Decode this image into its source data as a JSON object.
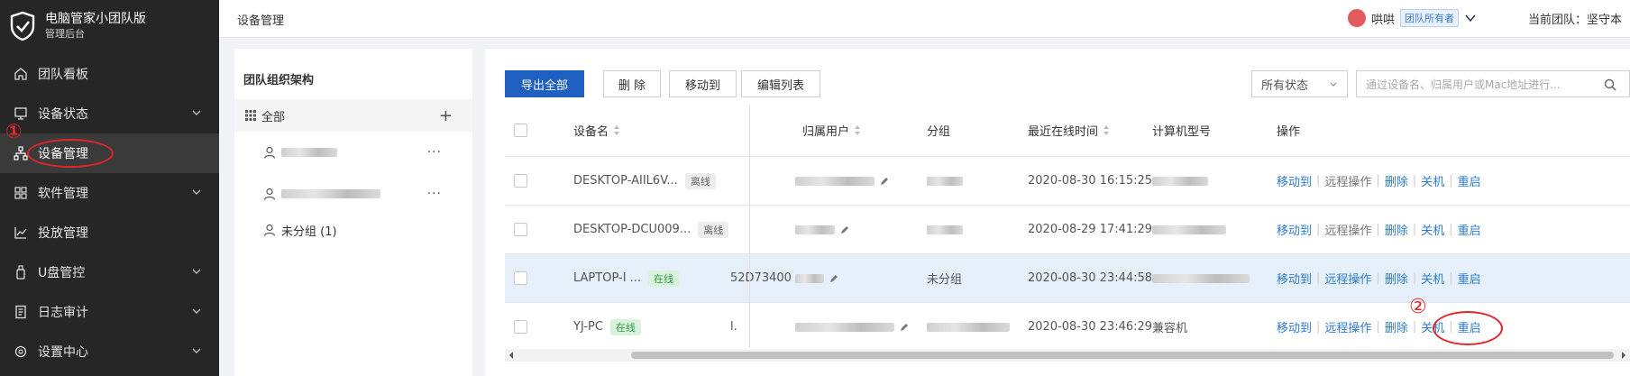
{
  "app": {
    "title": "电脑管家小团队版",
    "subtitle": "管理后台"
  },
  "sidebar": {
    "items": [
      {
        "label": "团队看板",
        "icon": "home-icon",
        "expandable": false
      },
      {
        "label": "设备状态",
        "icon": "monitor-icon",
        "expandable": true
      },
      {
        "label": "设备管理",
        "icon": "device-tree-icon",
        "expandable": false,
        "active": true
      },
      {
        "label": "软件管理",
        "icon": "apps-grid-icon",
        "expandable": true
      },
      {
        "label": "投放管理",
        "icon": "chart-line-icon",
        "expandable": false
      },
      {
        "label": "U盘管控",
        "icon": "usb-icon",
        "expandable": true
      },
      {
        "label": "日志审计",
        "icon": "document-icon",
        "expandable": true
      },
      {
        "label": "设置中心",
        "icon": "settings-icon",
        "expandable": true
      }
    ]
  },
  "annotations": {
    "mark1": "①",
    "mark2": "②"
  },
  "header": {
    "breadcrumb": "设备管理",
    "user_name": "哄哄",
    "role_badge": "团队所有者",
    "team_label": "当前团队：坚守本"
  },
  "org": {
    "title": "团队组织架构",
    "all_label": "全部",
    "nodes": [
      {
        "label": "",
        "blurred": true
      },
      {
        "label": "",
        "blurred": true
      },
      {
        "label": "未分组 (1)",
        "blurred": false
      }
    ]
  },
  "toolbar": {
    "export_all": "导出全部",
    "delete": "删 除",
    "move_to": "移动到",
    "edit_columns": "编辑列表",
    "status_filter": "所有状态",
    "search_placeholder": "通过设备名、归属用户或Mac地址进行..."
  },
  "table": {
    "columns": {
      "device_name": "设备名",
      "owner": "归属用户",
      "group": "分组",
      "last_online": "最近在线时间",
      "model": "计算机型号",
      "actions": "操作"
    },
    "rows": [
      {
        "device": "DESKTOP-AIIL6V...",
        "status": "离线",
        "online": false,
        "mid": "",
        "group": "",
        "last_online": "2020-08-30 16:15:25",
        "model": "",
        "selected": false
      },
      {
        "device": "DESKTOP-DCU009...",
        "status": "离线",
        "online": false,
        "mid": "",
        "group": "",
        "last_online": "2020-08-29 17:41:29",
        "model": "",
        "selected": false
      },
      {
        "device": "LAPTOP-I ...",
        "status": "在线",
        "online": true,
        "mid": "52D73400",
        "group": "未分组",
        "last_online": "2020-08-30 23:44:58",
        "model": "",
        "selected": true
      },
      {
        "device": "YJ-PC",
        "status": "在线",
        "online": true,
        "mid": "l.",
        "group": "",
        "last_online": "2020-08-30 23:46:29",
        "model": "兼容机",
        "selected": false
      }
    ],
    "actions": {
      "move_to": "移动到",
      "remote": "远程操作",
      "delete": "删除",
      "shutdown": "关机",
      "restart": "重启"
    }
  }
}
